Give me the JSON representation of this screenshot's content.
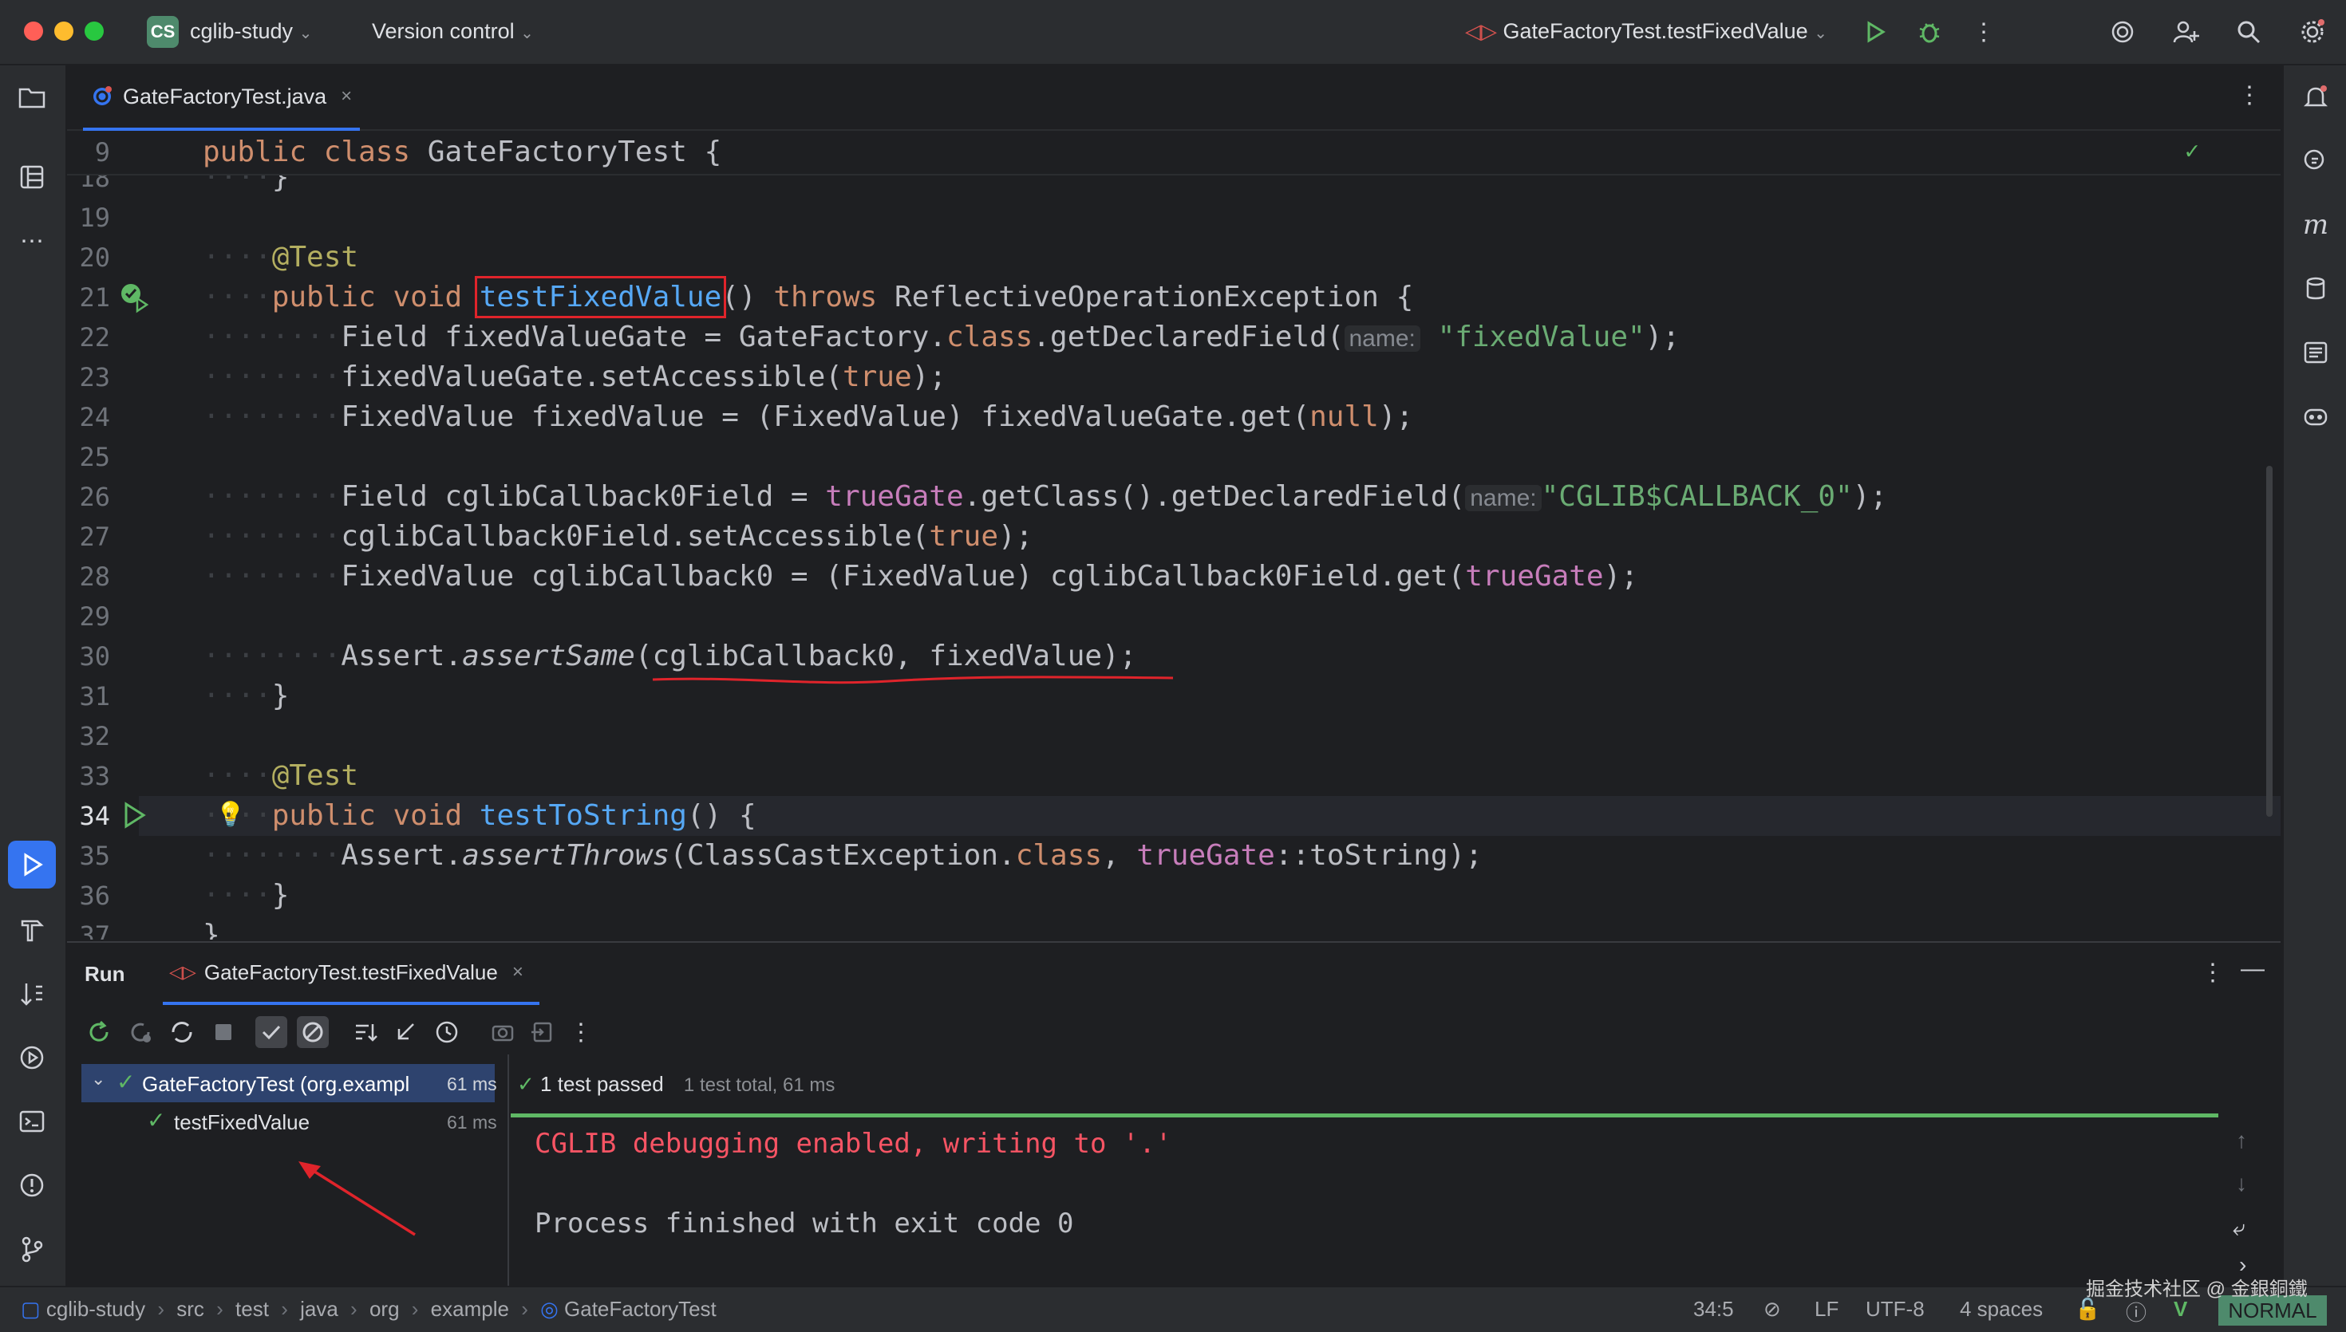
{
  "titlebar": {
    "project_initials": "CS",
    "project_name": "cglib-study",
    "vcs_label": "Version control",
    "run_config": "GateFactoryTest.testFixedValue"
  },
  "tabs": [
    {
      "label": "GateFactoryTest.java"
    }
  ],
  "editor": {
    "sticky_line_no": "9",
    "sticky_code": "public class GateFactoryTest {",
    "lines": [
      {
        "n": "18",
        "text": "}"
      },
      {
        "n": "19",
        "text": ""
      },
      {
        "n": "20",
        "text": "@Test"
      },
      {
        "n": "21",
        "text": "public void testFixedValue() throws ReflectiveOperationException {"
      },
      {
        "n": "22",
        "text": "Field fixedValueGate = GateFactory.class.getDeclaredField(name: \"fixedValue\");"
      },
      {
        "n": "23",
        "text": "fixedValueGate.setAccessible(true);"
      },
      {
        "n": "24",
        "text": "FixedValue fixedValue = (FixedValue) fixedValueGate.get(null);"
      },
      {
        "n": "25",
        "text": ""
      },
      {
        "n": "26",
        "text": "Field cglibCallback0Field = trueGate.getClass().getDeclaredField(name: \"CGLIB$CALLBACK_0\");"
      },
      {
        "n": "27",
        "text": "cglibCallback0Field.setAccessible(true);"
      },
      {
        "n": "28",
        "text": "FixedValue cglibCallback0 = (FixedValue) cglibCallback0Field.get(trueGate);"
      },
      {
        "n": "29",
        "text": ""
      },
      {
        "n": "30",
        "text": "Assert.assertSame(cglibCallback0, fixedValue);"
      },
      {
        "n": "31",
        "text": "}"
      },
      {
        "n": "32",
        "text": ""
      },
      {
        "n": "33",
        "text": "@Test"
      },
      {
        "n": "34",
        "text": "public void testToString() {"
      },
      {
        "n": "35",
        "text": "Assert.assertThrows(ClassCastException.class, trueGate::toString);"
      },
      {
        "n": "36",
        "text": "}"
      },
      {
        "n": "37",
        "text": "}"
      }
    ],
    "tokens": {
      "public": "public",
      "class": "class",
      "void": "void",
      "throws": "throws",
      "test_ann": "@Test",
      "classname": "GateFactoryTest",
      "brace_open": "{",
      "brace_close": "}",
      "m1": "testFixedValue",
      "m1_tail": "()",
      "exc": "ReflectiveOperationException {",
      "l22a": "Field fixedValueGate = GateFactory.",
      "l22b": "class",
      "l22c": ".getDeclaredField(",
      "hint_name": "name:",
      "l22str": "\"fixedValue\"",
      "l22end": ");",
      "l23a": "fixedValueGate.setAccessible(",
      "true_kw": "true",
      "l23end": ");",
      "l24a": "FixedValue fixedValue = (FixedValue) fixedValueGate.get(",
      "null_kw": "null",
      "l24end": ");",
      "l26a": "Field cglibCallback0Field = ",
      "trueGate": "trueGate",
      "l26b": ".getClass().getDeclaredField(",
      "l26str": "\"CGLIB$CALLBACK_0\"",
      "l26end": ");",
      "l27a": "cglibCallback0Field.setAccessible(",
      "l27end": ");",
      "l28a": "FixedValue cglibCallback0 = (FixedValue) cglibCallback0Field.get(",
      "l28end": ");",
      "l30a": "Assert.",
      "assertSame": "assertSame",
      "l30b": "(cglibCallback0, fixedValue);",
      "m2": "testToString",
      "m2_tail": "() {",
      "l35a": "Assert.",
      "assertThrows": "assertThrows",
      "l35b": "(ClassCastException.",
      "l35c": "class",
      "l35d": ", ",
      "l35e": "::toString);",
      "dot4": "····",
      "dot8": "········"
    }
  },
  "run": {
    "title": "Run",
    "tab_label": "GateFactoryTest.testFixedValue",
    "tree": [
      {
        "label": "GateFactoryTest (org.exampl",
        "time": "61 ms"
      },
      {
        "label": "testFixedValue",
        "time": "61 ms"
      }
    ],
    "status": "1 test passed",
    "summary": "1 test total, 61 ms",
    "console": [
      "CGLIB debugging enabled, writing to '.'",
      "",
      "Process finished with exit code 0"
    ],
    "progress": 1.0
  },
  "statusbar": {
    "breadcrumbs": [
      "cglib-study",
      "src",
      "test",
      "java",
      "org",
      "example",
      "GateFactoryTest"
    ],
    "position": "34:5",
    "line_sep": "LF",
    "encoding": "UTF-8",
    "indent": "4 spaces",
    "mode": "NORMAL",
    "watermark": "掘金技术社区 @ 金銀銅鐵"
  },
  "colors": {
    "accent": "#3574f0",
    "pass": "#5fb865",
    "error_text": "#f75464",
    "highlight_box": "#e0242b"
  }
}
